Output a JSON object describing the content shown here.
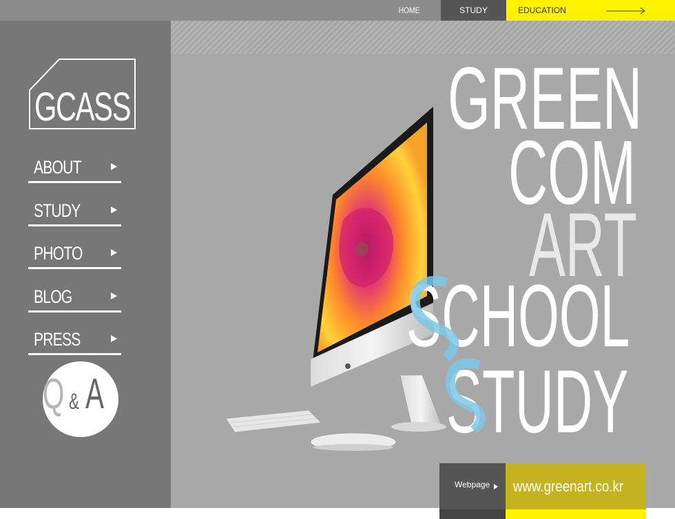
{
  "topnav": {
    "home": "HOME",
    "study": "STUDY",
    "education": "EDUCATION"
  },
  "logo": {
    "text": "GCASS"
  },
  "sidebar": {
    "items": [
      {
        "label": "ABOUT"
      },
      {
        "label": "STUDY"
      },
      {
        "label": "PHOTO"
      },
      {
        "label": "BLOG"
      },
      {
        "label": "PRESS"
      }
    ],
    "qa": {
      "q": "Q",
      "amp": "&",
      "a": "A"
    }
  },
  "hero": {
    "line1": "GREEN",
    "line2": "COM",
    "line3": "ART",
    "line4": "SCHOOL",
    "line5": "STUDY"
  },
  "footer": {
    "webpage_label": "Webpage",
    "url": "www.greenart.co.kr"
  },
  "colors": {
    "accent_yellow": "#fff200",
    "sidebar_gray": "#777777",
    "dark_gray": "#555555"
  }
}
